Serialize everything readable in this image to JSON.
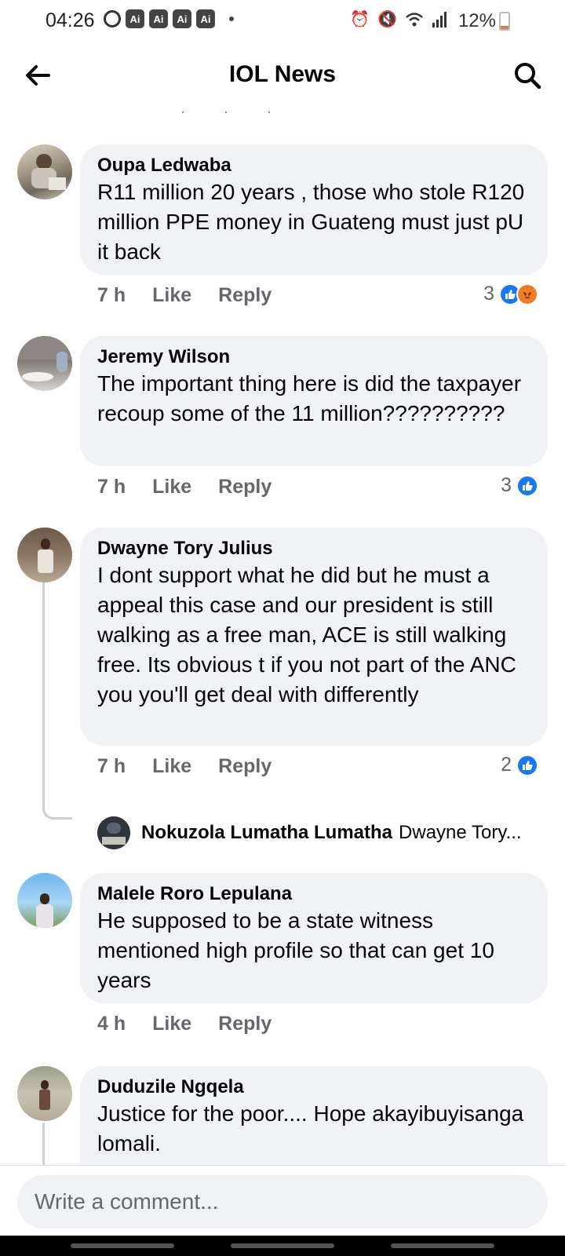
{
  "status_bar": {
    "time": "04:26",
    "ai_badges": [
      "Ai",
      "Ai",
      "Ai",
      "Ai"
    ],
    "battery": "12%"
  },
  "header": {
    "title": "IOL News"
  },
  "comments": [
    {
      "author": "Oupa Ledwaba",
      "text": "R11 million  20 years , those who stole R120 million PPE money in Guateng must just pU it back",
      "time": "7 h",
      "like_label": "Like",
      "reply_label": "Reply",
      "reaction_count": "3",
      "reactions": [
        "like",
        "angry"
      ]
    },
    {
      "author": "Jeremy Wilson",
      "text": "The important thing here is did the taxpayer recoup some of the 11 million??????????",
      "time": "7 h",
      "like_label": "Like",
      "reply_label": "Reply",
      "reaction_count": "3",
      "reactions": [
        "like"
      ]
    },
    {
      "author": "Dwayne Tory Julius",
      "text": "I dont support what he did but he must a appeal this case and our president is still walking as a free man, ACE is still walking free. Its obvious t if you not part of the ANC you you'll get deal with differently",
      "time": "7 h",
      "like_label": "Like",
      "reply_label": "Reply",
      "reaction_count": "2",
      "reactions": [
        "like"
      ]
    },
    {
      "author": "Malele Roro Lepulana",
      "text": "He supposed to be a state witness mentioned high profile so that can get 10 years",
      "time": "4 h",
      "like_label": "Like",
      "reply_label": "Reply"
    },
    {
      "author": "Duduzile Ngqela",
      "text": "Justice for the poor.... Hope akayibuyisanga lomali."
    }
  ],
  "reply_preview": {
    "author": "Nokuzola Lumatha Lumatha",
    "snippet": "Dwayne Tory..."
  },
  "composer": {
    "placeholder": "Write a comment..."
  }
}
